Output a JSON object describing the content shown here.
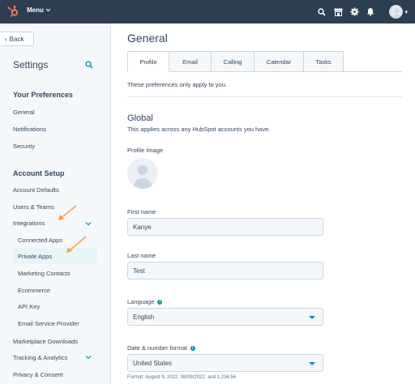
{
  "topnav": {
    "menu_label": "Menu",
    "icons": [
      "hubspot-logo-icon",
      "search-icon",
      "marketplace-icon",
      "gear-icon",
      "bell-icon",
      "avatar"
    ]
  },
  "sidebar": {
    "back_label": "Back",
    "title": "Settings",
    "preferences_heading": "Your Preferences",
    "preferences_items": [
      "General",
      "Notifications",
      "Security"
    ],
    "account_heading": "Account Setup",
    "account_items": [
      "Account Defaults",
      "Users & Teams",
      "Integrations"
    ],
    "integrations_items": [
      "Connected Apps",
      "Private Apps",
      "Marketing Contacts",
      "Ecommerce",
      "API Key",
      "Email Service Provider"
    ],
    "more_items": [
      "Marketplace Downloads",
      "Tracking & Analytics",
      "Privacy & Consent"
    ]
  },
  "main": {
    "title": "General",
    "tabs": [
      "Profile",
      "Email",
      "Calling",
      "Calendar",
      "Tasks"
    ],
    "active_tab": "Profile",
    "prefs_note": "These preferences only apply to you.",
    "global_title": "Global",
    "global_sub": "This applies across any HubSpot accounts you have.",
    "profile_image_label": "Profile Image",
    "first_name_label": "First name",
    "first_name_value": "Kanye",
    "last_name_label": "Last name",
    "last_name_value": "Test",
    "language_label": "Language",
    "language_value": "English",
    "date_format_label": "Date & number format",
    "date_format_value": "United States",
    "format_note": "Format: August 9, 2022, 08/09/2022, and 1,234.56"
  },
  "colors": {
    "nav_bg": "#2d3e50",
    "accent": "#0091ae",
    "arrow": "#f5a045",
    "hubspot_orange": "#ff7a59"
  }
}
